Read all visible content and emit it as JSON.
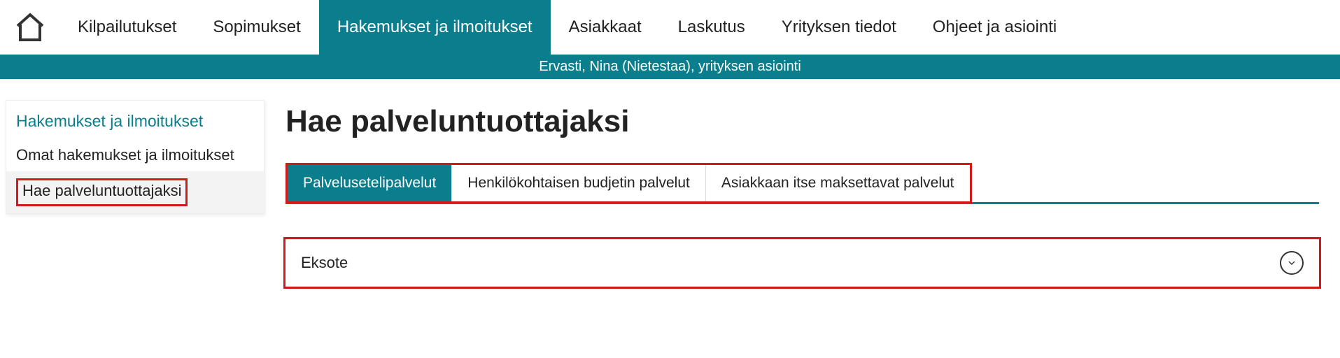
{
  "nav": {
    "items": [
      {
        "label": "Kilpailutukset"
      },
      {
        "label": "Sopimukset"
      },
      {
        "label": "Hakemukset ja ilmoitukset"
      },
      {
        "label": "Asiakkaat"
      },
      {
        "label": "Laskutus"
      },
      {
        "label": "Yrityksen tiedot"
      },
      {
        "label": "Ohjeet ja asiointi"
      }
    ],
    "active_index": 2
  },
  "userbar": "Ervasti, Nina (Nietestaa), yrityksen asiointi",
  "sidebar": {
    "header": "Hakemukset ja ilmoitukset",
    "items": [
      {
        "label": "Omat hakemukset ja ilmoitukset"
      },
      {
        "label": "Hae palveluntuottajaksi"
      }
    ],
    "active_index": 1
  },
  "main": {
    "title": "Hae palveluntuottajaksi",
    "tabs": [
      {
        "label": "Palvelusetelipalvelut"
      },
      {
        "label": "Henkilökohtaisen budjetin palvelut"
      },
      {
        "label": "Asiakkaan itse maksettavat palvelut"
      }
    ],
    "active_tab": 0,
    "accordion": {
      "label": "Eksote"
    }
  }
}
